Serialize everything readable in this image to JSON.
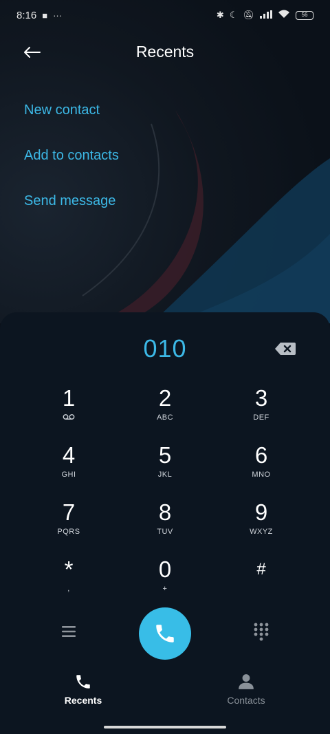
{
  "status_bar": {
    "time": "8:16",
    "battery": "56"
  },
  "header": {
    "title": "Recents"
  },
  "menu": {
    "items": [
      {
        "label": "New contact"
      },
      {
        "label": "Add to contacts"
      },
      {
        "label": "Send message"
      }
    ]
  },
  "dialer": {
    "number": "010",
    "keys": [
      {
        "digit": "1",
        "letters": ""
      },
      {
        "digit": "2",
        "letters": "ABC"
      },
      {
        "digit": "3",
        "letters": "DEF"
      },
      {
        "digit": "4",
        "letters": "GHI"
      },
      {
        "digit": "5",
        "letters": "JKL"
      },
      {
        "digit": "6",
        "letters": "MNO"
      },
      {
        "digit": "7",
        "letters": "PQRS"
      },
      {
        "digit": "8",
        "letters": "TUV"
      },
      {
        "digit": "9",
        "letters": "WXYZ"
      },
      {
        "digit": "*",
        "letters": ","
      },
      {
        "digit": "0",
        "letters": "+"
      },
      {
        "digit": "#",
        "letters": ""
      }
    ]
  },
  "bottom_nav": {
    "recents_label": "Recents",
    "contacts_label": "Contacts"
  },
  "colors": {
    "accent": "#3cb8e6",
    "call_button": "#38bde7",
    "background": "#0b1119"
  }
}
